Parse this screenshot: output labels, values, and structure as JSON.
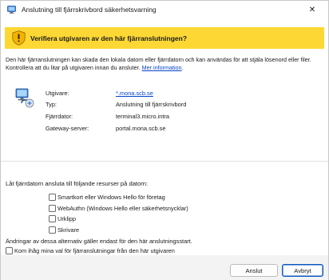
{
  "window": {
    "title": "Anslutning till fjärrskrivbord säkerhetsvarning",
    "close_glyph": "✕"
  },
  "banner": {
    "heading": "Verifiera utgivaren av den här fjärranslutningen?",
    "color": "#fdd835",
    "icon": "warning-shield-icon"
  },
  "description": {
    "text": "Den här fjärranslutningen kan skada den lokala datorn eller fjärrdatorn och kan användas för att stjäla lösenord eller filer. Kontrollera att du litar på utgivaren innan du ansluter.",
    "link": "Mer information"
  },
  "details": {
    "publisher_label": "Utgivare:",
    "publisher_value": "*.mona.scb.se",
    "type_label": "Typ:",
    "type_value": "Anslutning till fjärrskrivbord",
    "remote_label": "Fjärrdator:",
    "remote_value": "terminal3.micro.intra",
    "gateway_label": "Gateway-server:",
    "gateway_value": "portal.mona.scb.se"
  },
  "resources": {
    "prompt": "Låt fjärrdatorn ansluta till följande resurser på datorn:",
    "items": [
      {
        "label": "Smartkort eller Windows Hello för företag",
        "checked": false
      },
      {
        "label": "WebAuthn (Windows Hello eller säkerhetsnycklar)",
        "checked": false
      },
      {
        "label": "Urklipp",
        "checked": false
      },
      {
        "label": "Skrivare",
        "checked": false
      }
    ]
  },
  "note": "Ändringar av dessa alternativ gäller endast för den här anslutningsstart.",
  "remember": {
    "label": "Kom ihåg mina val för fjärranslutningar från den här utgivaren",
    "checked": false
  },
  "buttons": {
    "connect": "Anslut",
    "cancel": "Avbryt"
  },
  "colors": {
    "accent": "#0a59c0",
    "link": "#0645c8"
  }
}
